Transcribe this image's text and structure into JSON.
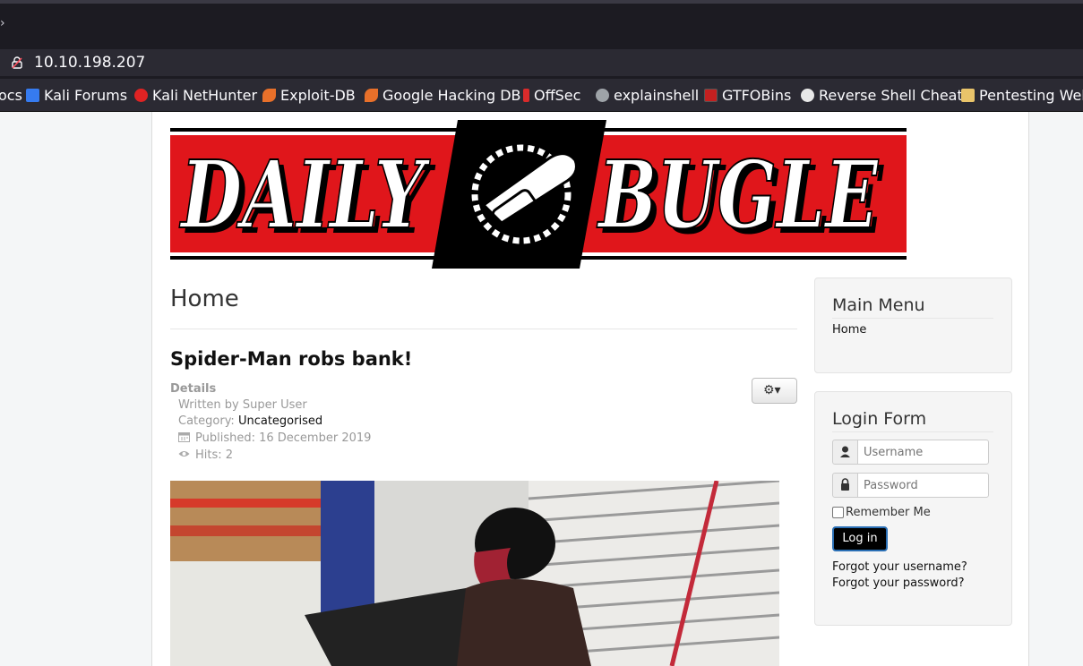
{
  "browser": {
    "tab_fragment": "›",
    "url": "10.10.198.207",
    "bookmarks": [
      {
        "label": "ocs",
        "color": "#2b2a33"
      },
      {
        "label": "Kali Forums",
        "color": "#367bf0"
      },
      {
        "label": "Kali NetHunter",
        "color": "#e02323"
      },
      {
        "label": "Exploit-DB",
        "color": "#e8702a"
      },
      {
        "label": "Google Hacking DB",
        "color": "#e8702a"
      },
      {
        "label": "OffSec",
        "color": "#d92b2b"
      },
      {
        "label": "explainshell",
        "color": "#9ea3a8"
      },
      {
        "label": "GTFOBins",
        "color": "#c42020"
      },
      {
        "label": "Reverse Shell Cheat",
        "color": "#e8e8e8"
      },
      {
        "label": "Pentesting Web",
        "color": "#e9c46a"
      }
    ]
  },
  "site": {
    "logo_word_left": "DAILY",
    "logo_word_right": "BUGLE",
    "page_title": "Home"
  },
  "article": {
    "title": "Spider-Man robs bank!",
    "details_label": "Details",
    "written_by": "Written by Super User",
    "category_label": "Category: ",
    "category_value": "Uncategorised",
    "published": "Published: 16 December 2019",
    "hits": "Hits: 2"
  },
  "sidebar": {
    "main_menu_title": "Main Menu",
    "main_menu_items": [
      "Home"
    ],
    "login_title": "Login Form",
    "username_placeholder": "Username",
    "password_placeholder": "Password",
    "remember_label": "Remember Me",
    "login_button": "Log in",
    "forgot_username": "Forgot your username?",
    "forgot_password": "Forgot your password?"
  },
  "colors": {
    "banner_red": "#e0161b",
    "banner_black": "#000000",
    "link_text": "#111111",
    "muted_text": "#999999"
  }
}
